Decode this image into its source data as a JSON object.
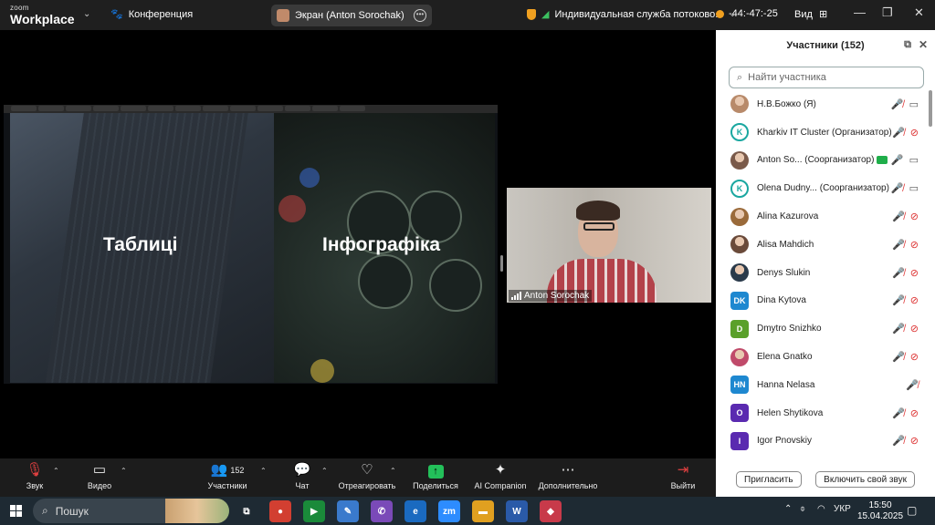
{
  "topbar": {
    "brand_small": "zoom",
    "brand_big": "Workplace",
    "meeting_label": "Конференция",
    "screen_label": "Экран (Anton Sorochak)",
    "stream_label": "Индивидуальная служба потоково...",
    "timer": "-44:-47:-25",
    "view_label": "Вид"
  },
  "slides": {
    "left_title": "Таблиці",
    "right_title": "Інфографіка"
  },
  "video": {
    "name": "Anton Sorochak"
  },
  "toolbar": {
    "sound": "Звук",
    "video": "Видео",
    "participants": "Участники",
    "participants_count": "152",
    "chat": "Чат",
    "react": "Отреагировать",
    "share": "Поделиться",
    "ai": "AI Companion",
    "more": "Дополнительно",
    "leave": "Выйти"
  },
  "panel": {
    "title": "Участники (152)",
    "search_placeholder": "Найти участника",
    "invite": "Пригласить",
    "unmute": "Включить свой звук",
    "participants": [
      {
        "name": "Н.В.Божко (Я)",
        "avatar": "photo",
        "color": "#b88a6a",
        "initials": "",
        "mic": "off",
        "cam": "on"
      },
      {
        "name": "Kharkiv IT Cluster (Организатор)",
        "avatar": "logo",
        "color": "#1aa7a0",
        "initials": "K",
        "mic": "off",
        "cam": "off"
      },
      {
        "name": "Anton So... (Соорганизатор)",
        "avatar": "photo",
        "color": "#7a5a4a",
        "initials": "",
        "mic": "on",
        "cam": "on",
        "badge": true
      },
      {
        "name": "Olena Dudny... (Соорганизатор)",
        "avatar": "logo",
        "color": "#1aa7a0",
        "initials": "K",
        "mic": "off",
        "cam": "on"
      },
      {
        "name": "Alina Kazurova",
        "avatar": "photo",
        "color": "#9a6a3a",
        "initials": "",
        "mic": "off",
        "cam": "off"
      },
      {
        "name": "Alisa Mahdich",
        "avatar": "photo",
        "color": "#6a4a3a",
        "initials": "",
        "mic": "off",
        "cam": "off"
      },
      {
        "name": "Denys Slukin",
        "avatar": "photo",
        "color": "#2a3a4a",
        "initials": "",
        "mic": "off",
        "cam": "off"
      },
      {
        "name": "Dina Kytova",
        "avatar": "letters",
        "color": "#1e88d0",
        "initials": "DK",
        "mic": "off",
        "cam": "off"
      },
      {
        "name": "Dmytro Snizhko",
        "avatar": "letters",
        "color": "#5aa02a",
        "initials": "D",
        "mic": "off",
        "cam": "off"
      },
      {
        "name": "Elena Gnatko",
        "avatar": "photo",
        "color": "#c04a6a",
        "initials": "",
        "mic": "off",
        "cam": "off"
      },
      {
        "name": "Hanna Nelasa",
        "avatar": "letters",
        "color": "#1e88d0",
        "initials": "HN",
        "mic": "off",
        "cam": "none"
      },
      {
        "name": "Helen Shytikova",
        "avatar": "letters",
        "color": "#5a2ab0",
        "initials": "O",
        "mic": "off",
        "cam": "off"
      },
      {
        "name": "Igor Pnovskiy",
        "avatar": "letters",
        "color": "#5a2ab0",
        "initials": "I",
        "mic": "off",
        "cam": "off"
      }
    ]
  },
  "taskbar": {
    "search": "Пошук",
    "lang": "УКР",
    "time": "15:50",
    "date": "15.04.2025",
    "apps": [
      {
        "name": "task-view",
        "color": "transparent",
        "glyph": "⧉"
      },
      {
        "name": "chrome",
        "color": "#d23f31",
        "glyph": "●"
      },
      {
        "name": "meet",
        "color": "#1a8a3a",
        "glyph": "▶"
      },
      {
        "name": "paint",
        "color": "#3a7acc",
        "glyph": "✎"
      },
      {
        "name": "viber",
        "color": "#7a4ab8",
        "glyph": "✆"
      },
      {
        "name": "edge",
        "color": "#1a6ac0",
        "glyph": "e"
      },
      {
        "name": "zoom",
        "color": "#2d8cff",
        "glyph": "zm"
      },
      {
        "name": "explorer",
        "color": "#e0a020",
        "glyph": "▬"
      },
      {
        "name": "word",
        "color": "#2a5aa8",
        "glyph": "W"
      },
      {
        "name": "other",
        "color": "#c83a4a",
        "glyph": "◆"
      }
    ]
  }
}
